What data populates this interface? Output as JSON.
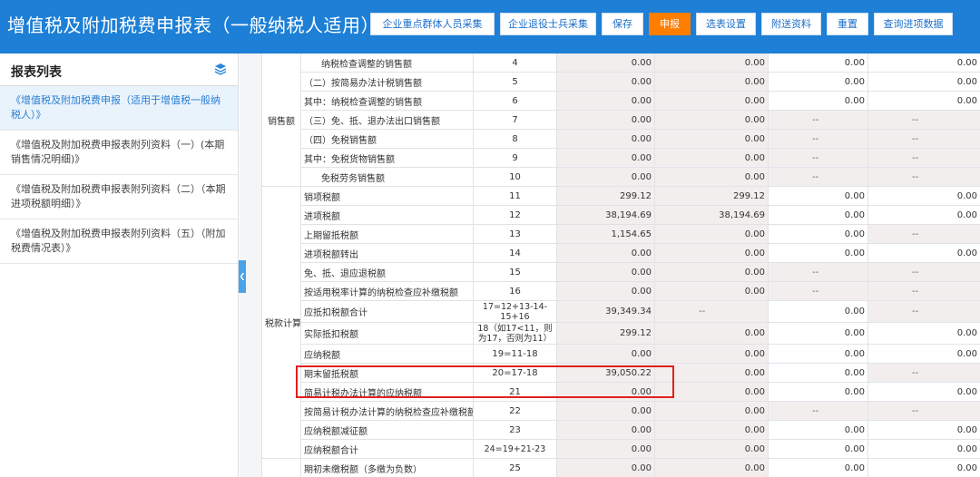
{
  "app": {
    "title": "增值税及附加税费申报表（一般纳税人适用）"
  },
  "toolbar": {
    "buttons": [
      {
        "label": "企业重点群体人员采集",
        "w": 137
      },
      {
        "label": "企业退役士兵采集",
        "w": 106
      },
      {
        "label": "保存",
        "w": 46
      },
      {
        "label": "申报",
        "w": 46,
        "active": true
      },
      {
        "label": "选表设置",
        "w": 66
      },
      {
        "label": "附送资料",
        "w": 66
      },
      {
        "label": "重置",
        "w": 46
      },
      {
        "label": "查询进项数据",
        "w": 87
      }
    ]
  },
  "sidebar": {
    "title": "报表列表",
    "items": [
      {
        "label": "《增值税及附加税费申报（适用于增值税一般纳税人）》",
        "active": true
      },
      {
        "label": "《增值税及附加税费申报表附列资料（一）(本期销售情况明细)》"
      },
      {
        "label": "《增值税及附加税费申报表附列资料（二）（本期进项税额明细）》"
      },
      {
        "label": "《增值税及附加税费申报表附列资料（五）（附加税费情况表）》"
      }
    ]
  },
  "table": {
    "groups": [
      {
        "name": "销售额"
      },
      {
        "name": "税款计算"
      }
    ],
    "rows": [
      {
        "label": "纳税检查调整的销售额",
        "indent": true,
        "num": "4",
        "c1": "0.00",
        "c2": "0.00",
        "c3": "0.00",
        "c4": "0.00"
      },
      {
        "label": "（二）按简易办法计税销售额",
        "num": "5",
        "c1": "0.00",
        "c2": "0.00",
        "c3": "0.00",
        "c4": "0.00"
      },
      {
        "label": "其中：纳税检查调整的销售额",
        "num": "6",
        "c1": "0.00",
        "c2": "0.00",
        "c3": "0.00",
        "c4": "0.00"
      },
      {
        "label": "（三）免、抵、退办法出口销售额",
        "num": "7",
        "c1": "0.00",
        "c2": "0.00",
        "c3": "--",
        "c4": "--"
      },
      {
        "label": "（四）免税销售额",
        "num": "8",
        "c1": "0.00",
        "c2": "0.00",
        "c3": "--",
        "c4": "--"
      },
      {
        "label": "其中：免税货物销售额",
        "num": "9",
        "c1": "0.00",
        "c2": "0.00",
        "c3": "--",
        "c4": "--"
      },
      {
        "label": "免税劳务销售额",
        "indent": true,
        "num": "10",
        "c1": "0.00",
        "c2": "0.00",
        "c3": "--",
        "c4": "--"
      },
      {
        "label": "销项税额",
        "num": "11",
        "c1": "299.12",
        "c2": "299.12",
        "c3": "0.00",
        "c4": "0.00"
      },
      {
        "label": "进项税额",
        "num": "12",
        "c1": "38,194.69",
        "c2": "38,194.69",
        "c3": "0.00",
        "c4": "0.00"
      },
      {
        "label": "上期留抵税额",
        "num": "13",
        "c1": "1,154.65",
        "c2": "0.00",
        "c3": "0.00",
        "c4": "--"
      },
      {
        "label": "进项税额转出",
        "num": "14",
        "c1": "0.00",
        "c2": "0.00",
        "c3": "0.00",
        "c4": "0.00"
      },
      {
        "label": "免、抵、退应退税额",
        "num": "15",
        "c1": "0.00",
        "c2": "0.00",
        "c3": "--",
        "c4": "--"
      },
      {
        "label": "按适用税率计算的纳税检查应补缴税额",
        "num": "16",
        "c1": "0.00",
        "c2": "0.00",
        "c3": "--",
        "c4": "--"
      },
      {
        "label": "应抵扣税额合计",
        "num": "17=12+13-14-15+16",
        "c1": "39,349.34",
        "c2": "--",
        "c3": "0.00",
        "c4": "--"
      },
      {
        "label": "实际抵扣税额",
        "num": "18（如17<11，则为17，否则为11）",
        "c1": "299.12",
        "c2": "0.00",
        "c3": "0.00",
        "c4": "0.00"
      },
      {
        "label": "应纳税额",
        "num": "19=11-18",
        "c1": "0.00",
        "c2": "0.00",
        "c3": "0.00",
        "c4": "0.00"
      },
      {
        "label": "期末留抵税额",
        "num": "20=17-18",
        "c1": "39,050.22",
        "c2": "0.00",
        "c3": "0.00",
        "c4": "--"
      },
      {
        "label": "简易计税办法计算的应纳税额",
        "num": "21",
        "c1": "0.00",
        "c2": "0.00",
        "c3": "0.00",
        "c4": "0.00"
      },
      {
        "label": "按简易计税办法计算的纳税检查应补缴税额",
        "num": "22",
        "c1": "0.00",
        "c2": "0.00",
        "c3": "--",
        "c4": "--"
      },
      {
        "label": "应纳税额减征额",
        "num": "23",
        "c1": "0.00",
        "c2": "0.00",
        "c3": "0.00",
        "c4": "0.00"
      },
      {
        "label": "应纳税额合计",
        "num": "24=19+21-23",
        "c1": "0.00",
        "c2": "0.00",
        "c3": "0.00",
        "c4": "0.00"
      },
      {
        "label": "期初未缴税额（多缴为负数）",
        "num": "25",
        "c1": "0.00",
        "c2": "0.00",
        "c3": "0.00",
        "c4": "0.00"
      }
    ]
  }
}
